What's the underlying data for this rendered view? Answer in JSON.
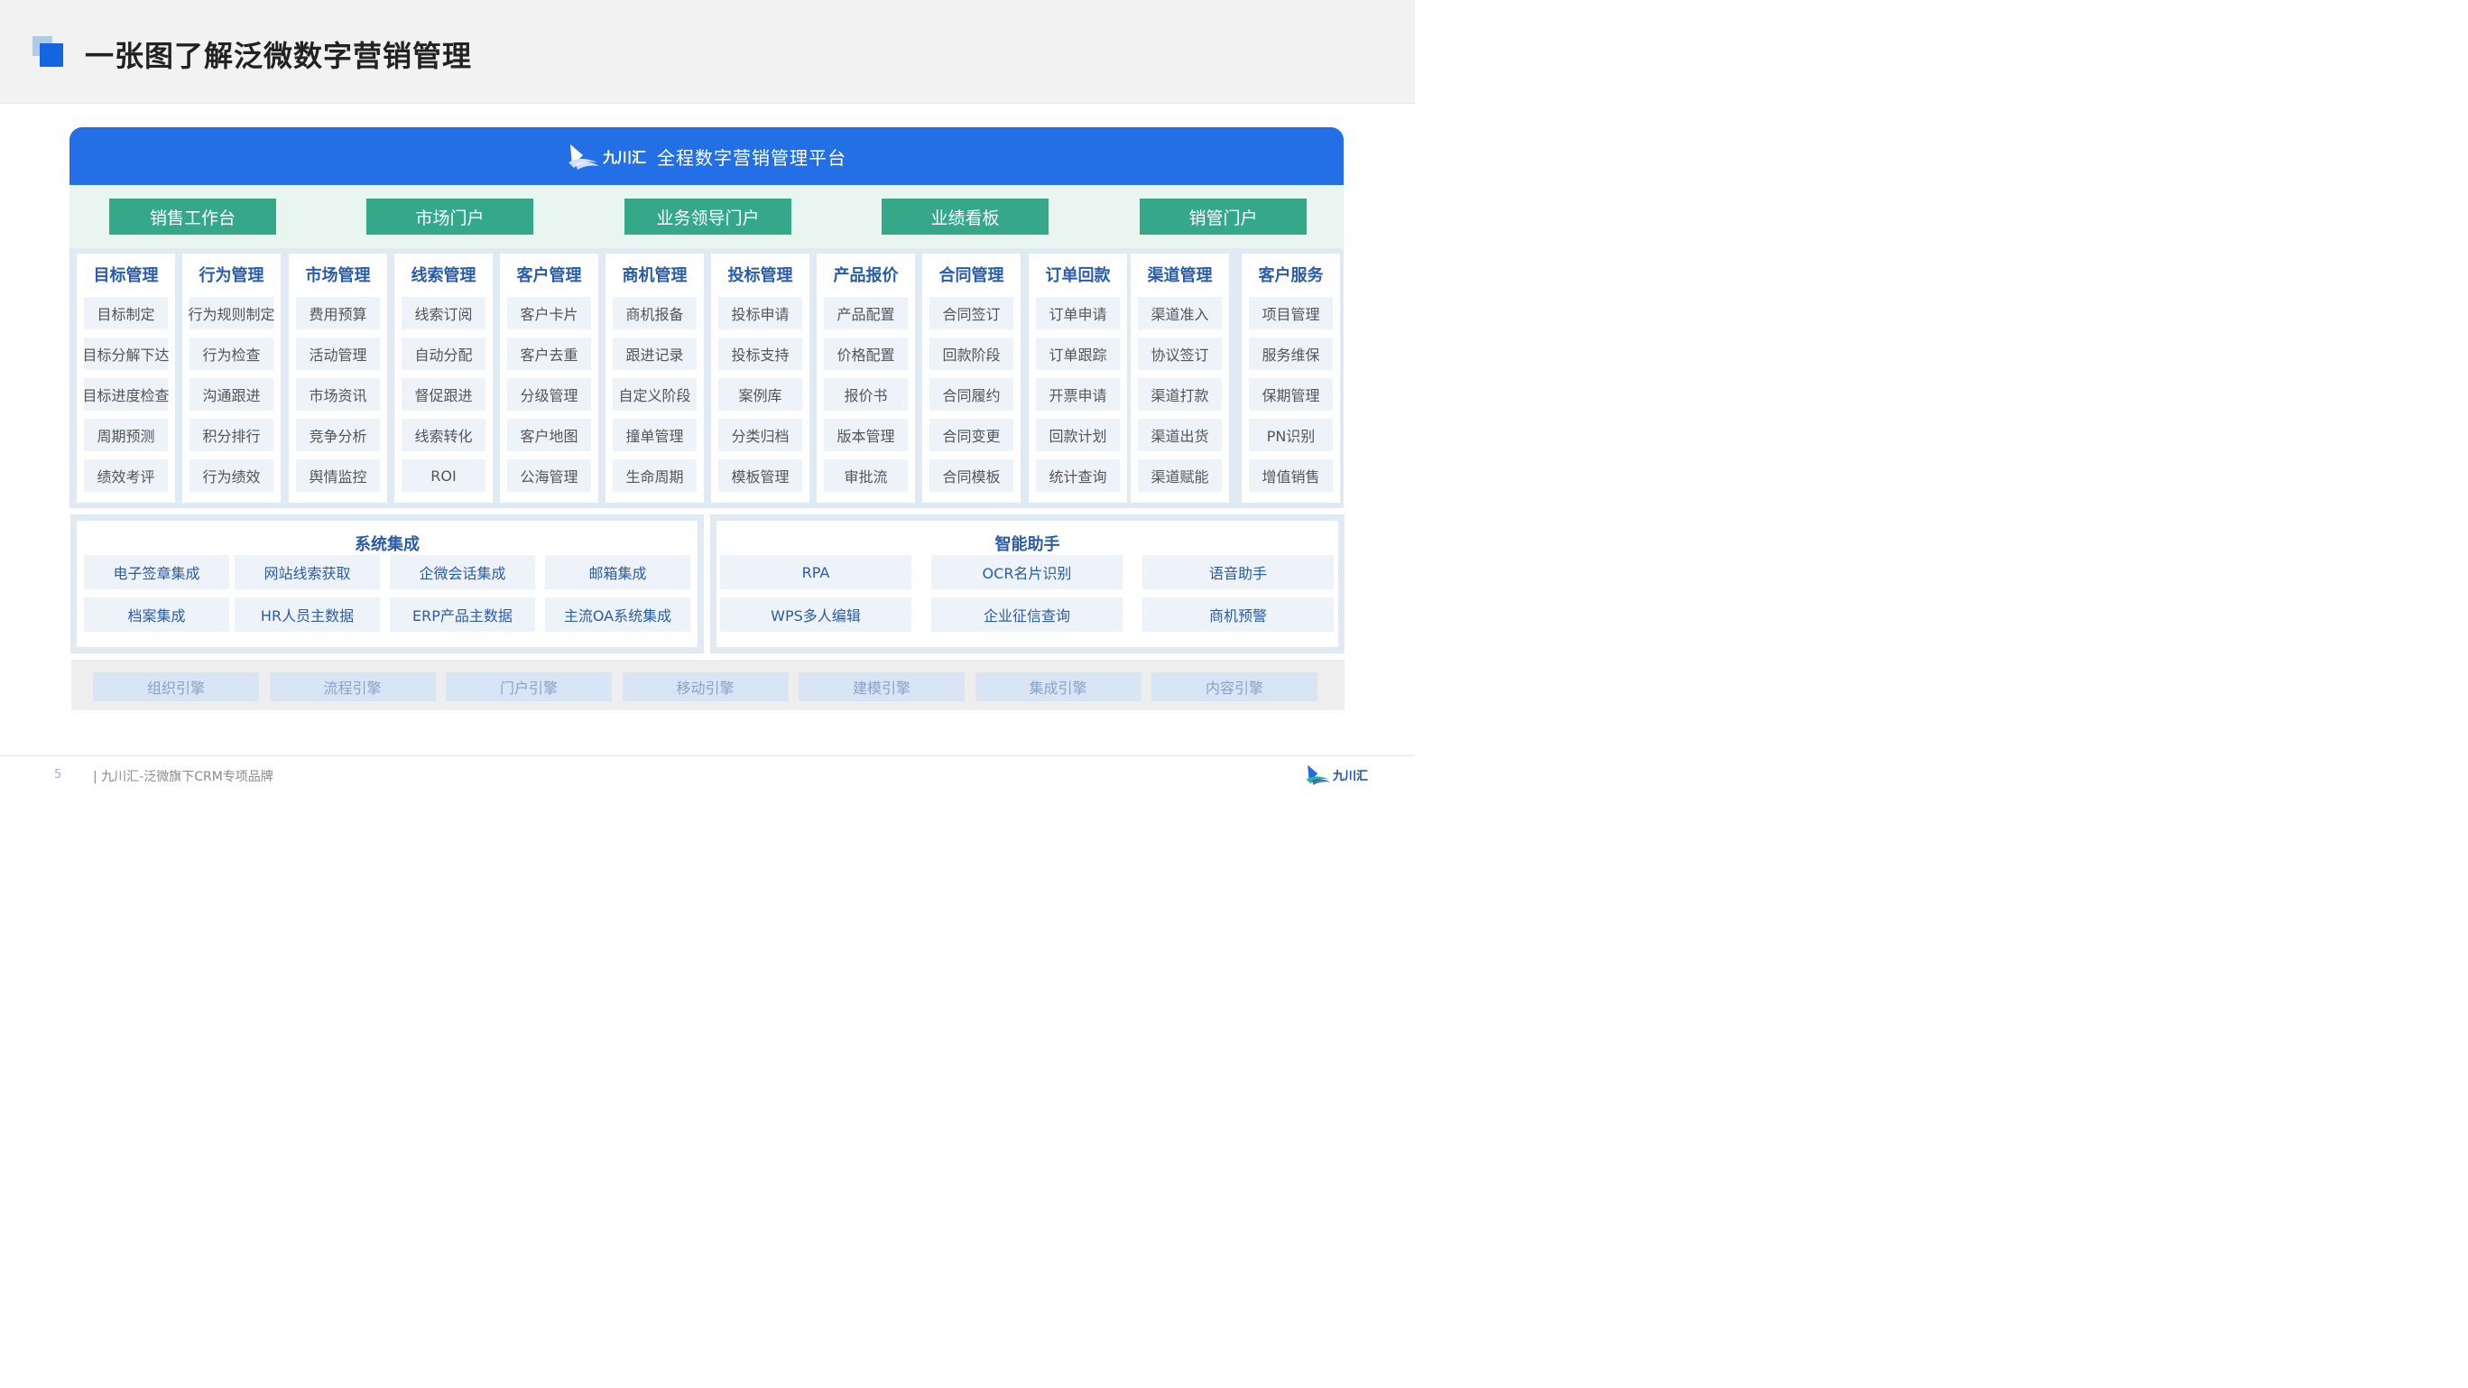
{
  "header": {
    "title": "一张图了解泛微数字营销管理"
  },
  "platform": {
    "brand": "九川汇",
    "title": "全程数字营销管理平台"
  },
  "portals": [
    "销售工作台",
    "市场门户",
    "业务领导门户",
    "业绩看板",
    "销管门户"
  ],
  "modules": [
    {
      "title": "目标管理",
      "items": [
        "目标制定",
        "目标分解下达",
        "目标进度检查",
        "周期预测",
        "绩效考评"
      ]
    },
    {
      "title": "行为管理",
      "items": [
        "行为规则制定",
        "行为检查",
        "沟通跟进",
        "积分排行",
        "行为绩效"
      ]
    },
    {
      "title": "市场管理",
      "items": [
        "费用预算",
        "活动管理",
        "市场资讯",
        "竞争分析",
        "舆情监控"
      ]
    },
    {
      "title": "线索管理",
      "items": [
        "线索订阅",
        "自动分配",
        "督促跟进",
        "线索转化",
        "ROI"
      ]
    },
    {
      "title": "客户管理",
      "items": [
        "客户卡片",
        "客户去重",
        "分级管理",
        "客户地图",
        "公海管理"
      ]
    },
    {
      "title": "商机管理",
      "items": [
        "商机报备",
        "跟进记录",
        "自定义阶段",
        "撞单管理",
        "生命周期"
      ]
    },
    {
      "title": "投标管理",
      "items": [
        "投标申请",
        "投标支持",
        "案例库",
        "分类归档",
        "模板管理"
      ]
    },
    {
      "title": "产品报价",
      "items": [
        "产品配置",
        "价格配置",
        "报价书",
        "版本管理",
        "审批流"
      ]
    },
    {
      "title": "合同管理",
      "items": [
        "合同签订",
        "回款阶段",
        "合同履约",
        "合同变更",
        "合同模板"
      ]
    },
    {
      "title": "订单回款",
      "items": [
        "订单申请",
        "订单跟踪",
        "开票申请",
        "回款计划",
        "统计查询"
      ]
    },
    {
      "title": "渠道管理",
      "items": [
        "渠道准入",
        "协议签订",
        "渠道打款",
        "渠道出货",
        "渠道赋能"
      ]
    },
    {
      "title": "客户服务",
      "items": [
        "项目管理",
        "服务维保",
        "保期管理",
        "PN识别",
        "增值销售"
      ]
    }
  ],
  "integration": {
    "title": "系统集成",
    "items": [
      "电子签章集成",
      "网站线索获取",
      "企微会话集成",
      "邮箱集成",
      "档案集成",
      "HR人员主数据",
      "ERP产品主数据",
      "主流OA系统集成"
    ]
  },
  "assistant": {
    "title": "智能助手",
    "items": [
      "RPA",
      "OCR名片识别",
      "语音助手",
      "WPS多人编辑",
      "企业征信查询",
      "商机预警"
    ]
  },
  "engines": [
    "组织引擎",
    "流程引擎",
    "门户引擎",
    "移动引擎",
    "建模引擎",
    "集成引擎",
    "内容引擎"
  ],
  "footer": {
    "page_number": "5",
    "text": "| 九川汇-泛微旗下CRM专项品牌",
    "brand": "九川汇"
  },
  "colors": {
    "primary_blue": "#2370e6",
    "portal_green": "#35a88a",
    "module_title": "#2a5ca8",
    "item_bg": "#eef3fa",
    "panel_bg": "#dfeaf5"
  }
}
